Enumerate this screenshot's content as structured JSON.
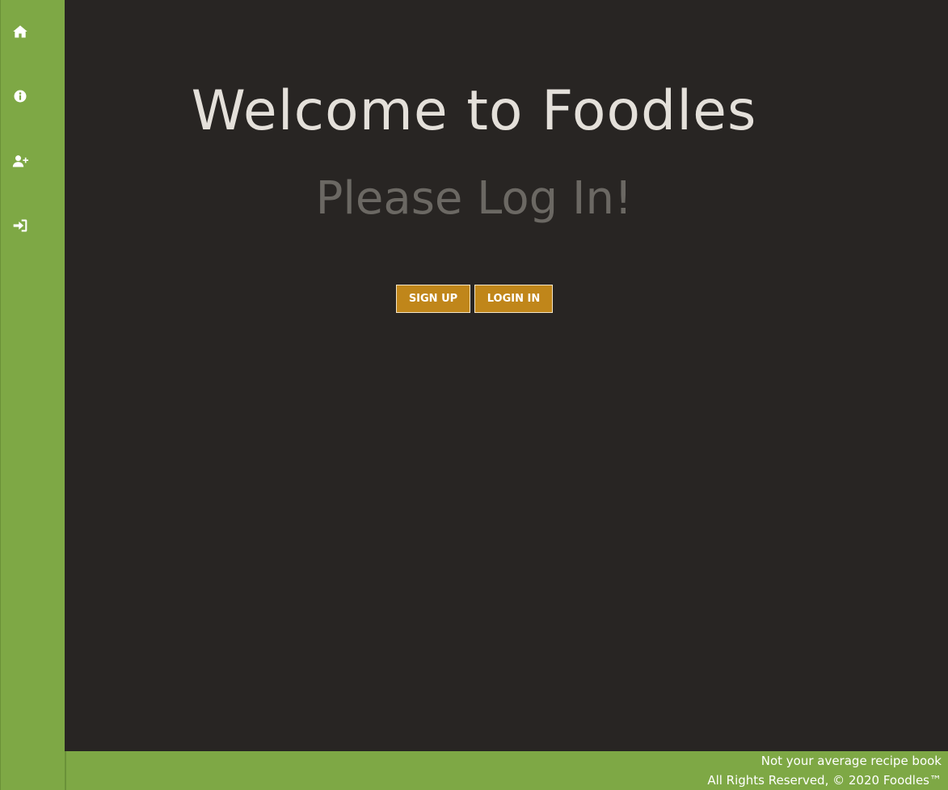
{
  "sidebar": {
    "items": [
      {
        "icon": "home-icon",
        "label": "Home"
      },
      {
        "icon": "info-icon",
        "label": "About"
      },
      {
        "icon": "user-plus-icon",
        "label": "Sign Up"
      },
      {
        "icon": "sign-in-icon",
        "label": "Log In"
      }
    ]
  },
  "main": {
    "title": "Welcome to Foodles",
    "subtitle": "Please Log In!",
    "signup_label": "SIGN UP",
    "login_label": "LOGIN IN"
  },
  "footer": {
    "tagline": "Not your average recipe book",
    "copyright": "All Rights Reserved, © 2020 Foodles™"
  },
  "colors": {
    "sidebar": "#7ea845",
    "background": "#282523",
    "button": "#c0861a",
    "title": "#e4e0da",
    "subtitle": "#6b6863"
  }
}
